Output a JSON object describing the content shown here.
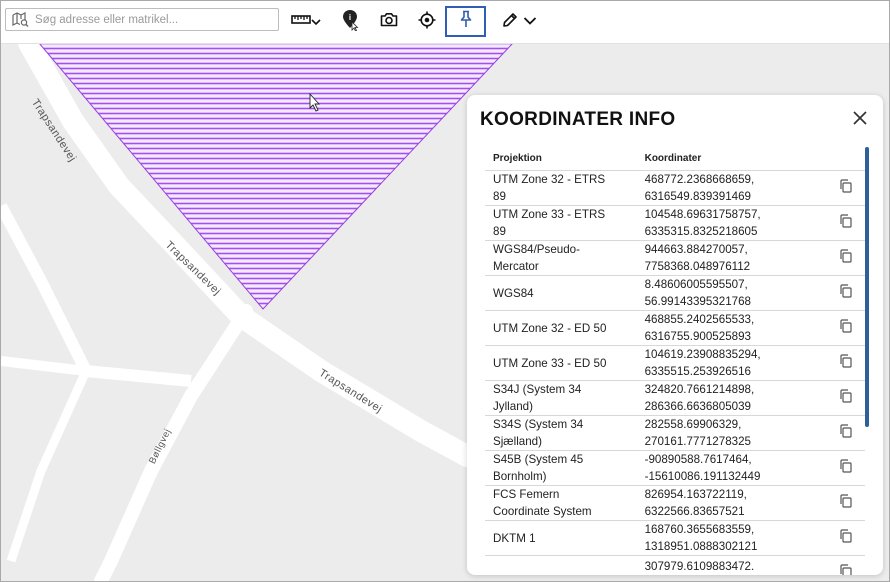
{
  "search": {
    "placeholder": "Søg adresse eller matrikel..."
  },
  "streets": {
    "main_1": "Trapsandevej",
    "main_2": "Trapsandevej",
    "main_3": "Trapsandevej",
    "side": "Bøllgvej"
  },
  "panel": {
    "title": "KOORDINATER INFO",
    "headers": {
      "projection": "Projektion",
      "coordinates": "Koordinater"
    },
    "rows": [
      {
        "proj_1": "UTM Zone 32 - ETRS",
        "proj_2": "89",
        "c1": "468772.2368668659,",
        "c2": "6316549.839391469"
      },
      {
        "proj_1": "UTM Zone 33 - ETRS",
        "proj_2": "89",
        "c1": "104548.69631758757,",
        "c2": "6335315.8325218605"
      },
      {
        "proj_1": "WGS84/Pseudo-",
        "proj_2": "Mercator",
        "c1": "944663.884270057,",
        "c2": "7758368.048976112"
      },
      {
        "proj_1": "WGS84",
        "proj_2": "",
        "c1": "8.48606005595507,",
        "c2": "56.99143395321768"
      },
      {
        "proj_1": "UTM Zone 32 - ED 50",
        "proj_2": "",
        "c1": "468855.2402565533,",
        "c2": "6316755.900525893"
      },
      {
        "proj_1": "UTM Zone 33 - ED 50",
        "proj_2": "",
        "c1": "104619.23908835294,",
        "c2": "6335515.253926516"
      },
      {
        "proj_1": "S34J (System 34",
        "proj_2": "Jylland)",
        "c1": "324820.7661214898,",
        "c2": "286366.6636805039"
      },
      {
        "proj_1": "S34S (System 34",
        "proj_2": "Sjælland)",
        "c1": "282558.69906329,",
        "c2": "270161.7771278325"
      },
      {
        "proj_1": "S45B (System 45",
        "proj_2": "Bornholm)",
        "c1": "-90890588.7617464,",
        "c2": "-15610086.191132449"
      },
      {
        "proj_1": "FCS Femern",
        "proj_2": "Coordinate System",
        "c1": "826954.163722119,",
        "c2": "6322566.83657521"
      },
      {
        "proj_1": "DKTM 1",
        "proj_2": "",
        "c1": "168760.3655683559,",
        "c2": "1318951.0888302121"
      },
      {
        "proj_1": "",
        "proj_2": "",
        "c1": "307979.6109883472.",
        "c2": ""
      }
    ]
  },
  "colors": {
    "accent": "#2f5fb0",
    "hatch": "#a64ff0",
    "road": "#ffffff",
    "map_bg": "#ececec",
    "scrollbar": "#2f5f9a"
  },
  "icons": [
    "map-search-icon",
    "ruler-icon",
    "chevron-down-icon",
    "map-pin-info-icon",
    "camera-icon",
    "locate-icon",
    "pin-icon",
    "pencil-icon",
    "close-icon",
    "copy-icon"
  ]
}
